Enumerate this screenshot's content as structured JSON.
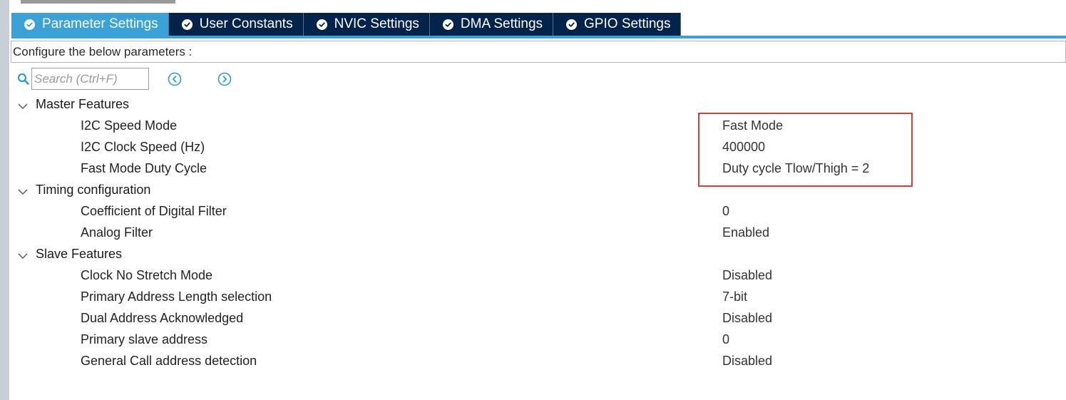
{
  "tabs": [
    {
      "label": "Parameter Settings",
      "active": true,
      "icon": "check-circle-icon"
    },
    {
      "label": "User Constants",
      "active": false,
      "icon": "check-circle-icon"
    },
    {
      "label": "NVIC Settings",
      "active": false,
      "icon": "check-circle-icon"
    },
    {
      "label": "DMA Settings",
      "active": false,
      "icon": "check-circle-icon"
    },
    {
      "label": "GPIO Settings",
      "active": false,
      "icon": "check-circle-icon"
    }
  ],
  "config": {
    "title": "Configure the below parameters :"
  },
  "search": {
    "placeholder": "Search (Ctrl+F)",
    "icon": "search-icon",
    "prev_icon": "circle-chevron-left-icon",
    "next_icon": "circle-chevron-right-icon"
  },
  "groups": [
    {
      "label": "Master Features",
      "params": [
        {
          "label": "I2C Speed Mode",
          "value": "Fast Mode"
        },
        {
          "label": "I2C Clock Speed (Hz)",
          "value": "400000"
        },
        {
          "label": "Fast Mode Duty Cycle",
          "value": "Duty cycle Tlow/Thigh = 2"
        }
      ]
    },
    {
      "label": "Timing configuration",
      "params": [
        {
          "label": "Coefficient of Digital Filter",
          "value": "0"
        },
        {
          "label": "Analog Filter",
          "value": "Enabled"
        }
      ]
    },
    {
      "label": "Slave Features",
      "params": [
        {
          "label": "Clock No Stretch Mode",
          "value": "Disabled"
        },
        {
          "label": "Primary Address Length selection",
          "value": "7-bit"
        },
        {
          "label": "Dual Address Acknowledged",
          "value": "Disabled"
        },
        {
          "label": "Primary slave address",
          "value": "0"
        },
        {
          "label": "General Call address detection",
          "value": "Disabled"
        }
      ]
    }
  ],
  "colors": {
    "tab_active": "#3aa2d6",
    "tab_inactive": "#03234b",
    "highlight": "#dc3b3b",
    "icon_blue": "#2f9bd6"
  }
}
